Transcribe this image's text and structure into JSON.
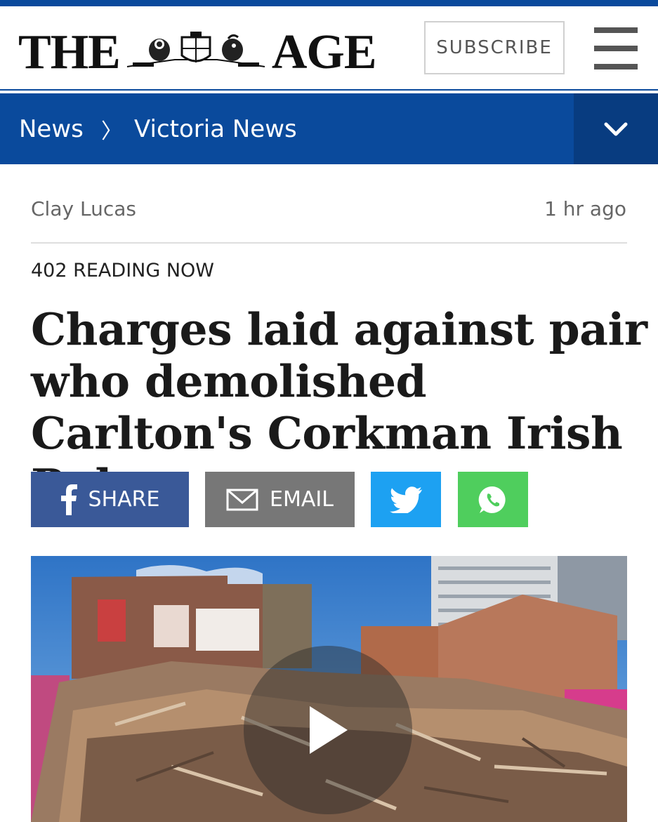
{
  "masthead": {
    "logo_left": "THE",
    "logo_right": "AGE",
    "subscribe_label": "SUBSCRIBE",
    "menu_icon": "hamburger-menu-icon"
  },
  "nav": {
    "crumbs": [
      "News",
      "Victoria News"
    ],
    "separator": "〉",
    "toggle_icon": "chevron-down-icon"
  },
  "article": {
    "author": "Clay Lucas",
    "time_ago": "1 hr ago",
    "reading_now": "402 READING NOW",
    "headline": "Charges laid against pair who demolished Carlton's Corkman Irish Pub"
  },
  "share": {
    "facebook_label": "SHARE",
    "email_label": "EMAIL",
    "twitter_icon": "twitter-icon",
    "whatsapp_icon": "whatsapp-icon"
  },
  "media": {
    "play_icon": "play-icon"
  },
  "colors": {
    "brand_blue": "#0a4a9c",
    "facebook": "#3a5998",
    "email": "#777777",
    "twitter": "#1da1f2",
    "whatsapp": "#4fce5d"
  }
}
